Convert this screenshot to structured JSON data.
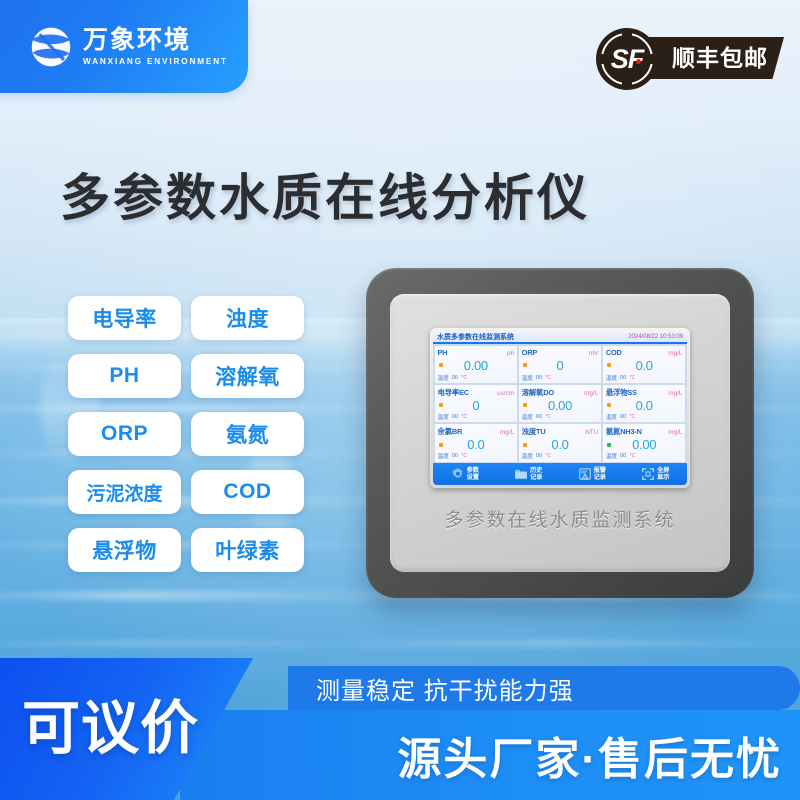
{
  "brand": {
    "logo_icon": "globe-swoosh-logo",
    "name_cn": "万象环境",
    "name_en": "WANXIANG ENVIRONMENT"
  },
  "shipping_badge": {
    "logo_icon": "sf-express-icon",
    "logo_text": "SF",
    "label": "顺丰包邮"
  },
  "title": "多参数水质在线分析仪",
  "parameters": [
    {
      "label": "电导率"
    },
    {
      "label": "浊度"
    },
    {
      "label": "PH"
    },
    {
      "label": "溶解氧"
    },
    {
      "label": "ORP"
    },
    {
      "label": "氨氮"
    },
    {
      "label": "污泥浓度"
    },
    {
      "label": "COD"
    },
    {
      "label": "悬浮物"
    },
    {
      "label": "叶绿素"
    }
  ],
  "device": {
    "front_label": "多参数在线水质监测系统",
    "screen": {
      "header_title": "水质多参数在线监测系统",
      "timestamp": "2024/08/22 10:53:09",
      "temp_label": "温度",
      "temp_value": "00",
      "temp_unit": "℃",
      "cells": [
        {
          "name": "PH",
          "unit": "ph",
          "value": "0.00",
          "status": "on"
        },
        {
          "name": "ORP",
          "unit": "mV",
          "value": "0",
          "status": "on"
        },
        {
          "name": "COD",
          "unit": "mg/L",
          "value": "0.0",
          "status": "on"
        },
        {
          "name": "电导率EC",
          "unit": "us/cm",
          "value": "0",
          "status": "on"
        },
        {
          "name": "溶解氧DO",
          "unit": "mg/L",
          "value": "0.00",
          "status": "on"
        },
        {
          "name": "悬浮物SS",
          "unit": "mg/L",
          "value": "0.0",
          "status": "on"
        },
        {
          "name": "余氯BR",
          "unit": "mg/L",
          "value": "0.0",
          "status": "on"
        },
        {
          "name": "浊度TU",
          "unit": "NTU",
          "value": "0.0",
          "status": "on"
        },
        {
          "name": "氨氮NH3-N",
          "unit": "mg/L",
          "value": "0.00",
          "status": "ok"
        }
      ],
      "toolbar": [
        {
          "icon": "gear-icon",
          "line1": "参数",
          "line2": "设置"
        },
        {
          "icon": "folder-icon",
          "line1": "历史",
          "line2": "记录"
        },
        {
          "icon": "alarm-doc-icon",
          "line1": "报警",
          "line2": "记录"
        },
        {
          "icon": "fullscreen-icon",
          "line1": "全屏",
          "line2": "显示"
        }
      ]
    }
  },
  "promo": {
    "price_tag": "可议价",
    "feature_line": "测量稳定  抗干扰能力强",
    "service_line": "源头厂家·售后无忧"
  },
  "colors": {
    "brand_blue": "#1e7ae8",
    "pill_text": "#1a8ceb",
    "title_dark": "#2b2d30",
    "lcd_value": "#21a6dd",
    "lcd_unit": "#e568b0",
    "status_on": "#ff9a18",
    "status_ok": "#22bb55",
    "badge_dark": "#2b2018"
  }
}
